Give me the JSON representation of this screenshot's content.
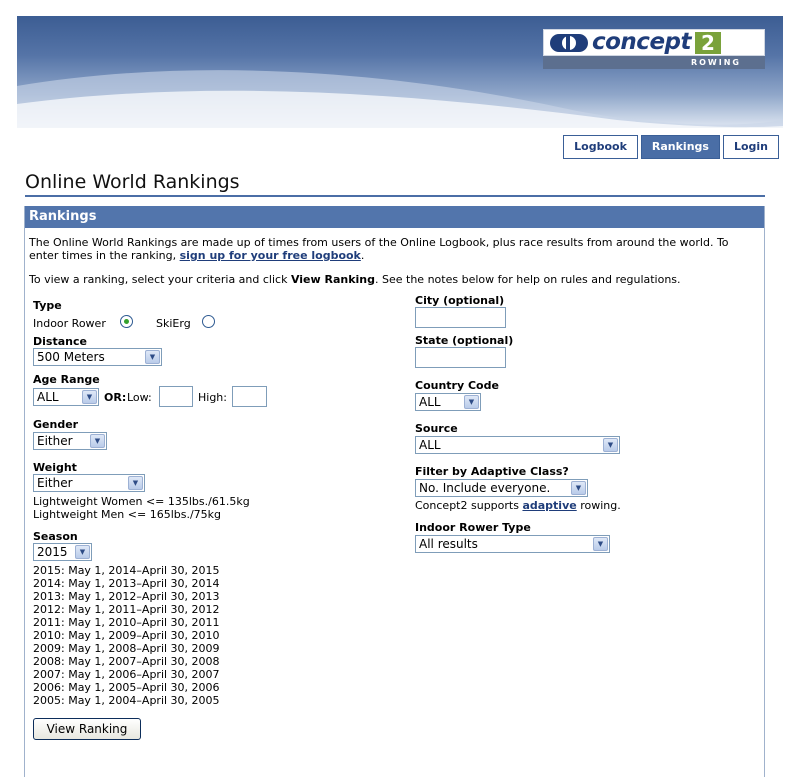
{
  "brand": {
    "logo_text": "concept",
    "logo_number": "2",
    "logo_sub": "ROWING"
  },
  "nav": {
    "items": [
      "Logbook",
      "Rankings",
      "Login"
    ],
    "active": "Rankings"
  },
  "page": {
    "title": "Online World Rankings"
  },
  "panel": {
    "heading": "Rankings",
    "intro_text": "The Online World Rankings are made up of times from users of the Online Logbook, plus race results from around the world. To enter times in the ranking, ",
    "intro_link": "sign up for your free logbook",
    "intro_end": ".",
    "criteria_pre": "To view a ranking, select your criteria and click ",
    "criteria_bold": "View Ranking",
    "criteria_post": ". See the notes below for help on rules and regulations."
  },
  "form": {
    "type_label": "Type",
    "type_options": [
      "Indoor Rower",
      "SkiErg"
    ],
    "type_selected": "Indoor Rower",
    "distance_label": "Distance",
    "distance_value": "500 Meters",
    "age_label": "Age Range",
    "age_value": "ALL",
    "age_or": "OR:",
    "age_low": "Low:",
    "age_high": "High:",
    "gender_label": "Gender",
    "gender_value": "Either",
    "weight_label": "Weight",
    "weight_value": "Either",
    "weight_note_women": "Lightweight Women <= 135lbs./61.5kg",
    "weight_note_men": "Lightweight Men <= 165lbs./75kg",
    "season_label": "Season",
    "season_value": "2015",
    "seasons": [
      "2015: May 1, 2014–April 30, 2015",
      "2014: May 1, 2013–April 30, 2014",
      "2013: May 1, 2012–April 30, 2013",
      "2012: May 1, 2011–April 30, 2012",
      "2011: May 1, 2010–April 30, 2011",
      "2010: May 1, 2009–April 30, 2010",
      "2009: May 1, 2008–April 30, 2009",
      "2008: May 1, 2007–April 30, 2008",
      "2007: May 1, 2006–April 30, 2007",
      "2006: May 1, 2005–April 30, 2006",
      "2005: May 1, 2004–April 30, 2005"
    ],
    "view_button": "View Ranking",
    "city_label": "City (optional)",
    "state_label": "State (optional)",
    "country_label": "Country Code",
    "country_value": "ALL",
    "source_label": "Source",
    "source_value": "ALL",
    "adaptive_label": "Filter by Adaptive Class?",
    "adaptive_value": "No. Include everyone.",
    "adaptive_note_pre": "Concept2 supports ",
    "adaptive_note_link": "adaptive",
    "adaptive_note_post": " rowing.",
    "rower_type_label": "Indoor Rower Type",
    "rower_type_value": "All results"
  },
  "colors": {
    "accent": "#4b6ea6",
    "link": "#1f3d7a",
    "radio_on": "#35a12d"
  }
}
